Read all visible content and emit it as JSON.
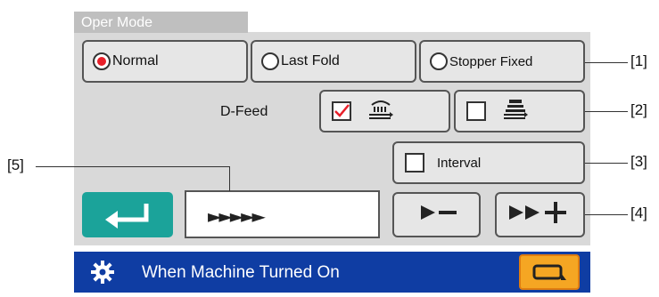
{
  "panel": {
    "tab_label": "Oper Mode",
    "mode_options": [
      {
        "label": "Normal",
        "selected": true
      },
      {
        "label": "Last Fold",
        "selected": false
      },
      {
        "label": "Stopper Fixed",
        "selected": false
      }
    ],
    "dfeed": {
      "label": "D-Feed",
      "options": [
        {
          "icon": "feed-rollers-icon",
          "checked": true
        },
        {
          "icon": "stacked-feed-icon",
          "checked": false
        }
      ]
    },
    "interval": {
      "label": "Interval",
      "checked": false
    },
    "controls": {
      "enter_icon": "enter-return-icon",
      "speed_display": "►►►►►",
      "minus_icon": "speed-minus-icon",
      "plus_icon": "speed-plus-icon"
    }
  },
  "callouts": [
    "[1]",
    "[2]",
    "[3]",
    "[4]",
    "[5]"
  ],
  "status_bar": {
    "icon": "gear-icon",
    "text": "When Machine Turned On",
    "button_icon": "exit-icon"
  },
  "colors": {
    "panel_bg": "#d9d9d9",
    "radio_selected": "#e8202a",
    "check_mark": "#e8202a",
    "enter_button": "#1ba39a",
    "status_bar": "#0f3da3",
    "status_button": "#f5a623"
  }
}
